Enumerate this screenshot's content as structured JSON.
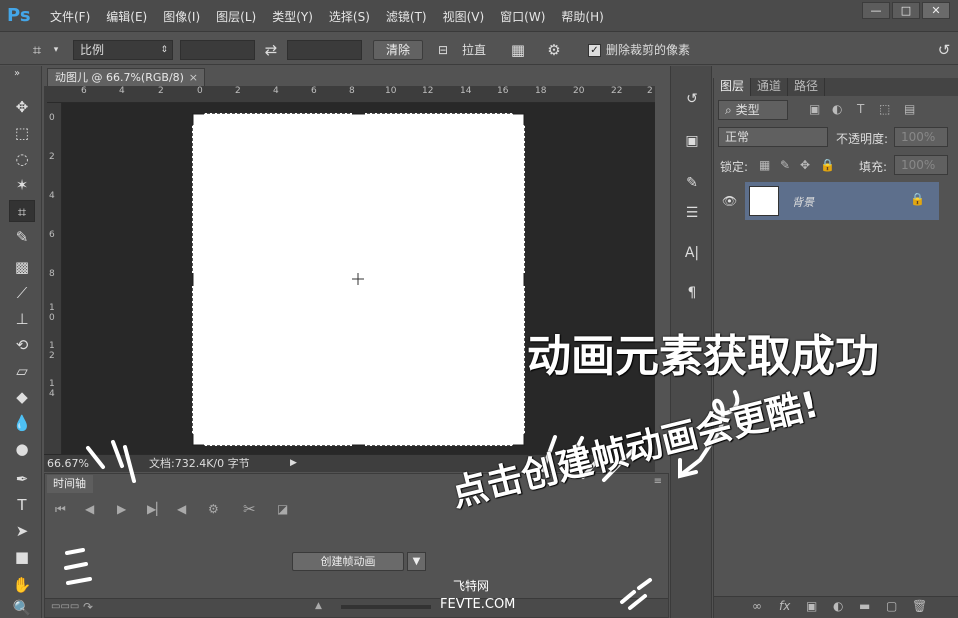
{
  "app": {
    "logo": "Ps"
  },
  "menu": [
    "文件(F)",
    "编辑(E)",
    "图像(I)",
    "图层(L)",
    "类型(Y)",
    "选择(S)",
    "滤镜(T)",
    "视图(V)",
    "窗口(W)",
    "帮助(H)"
  ],
  "window_buttons": {
    "minimize": "—",
    "restore": "□",
    "close": "✕"
  },
  "options": {
    "ratio": "比例",
    "swap_icon": "⇄",
    "clear": "清除",
    "straighten": "拉直",
    "delete_cropped": "删除裁剪的像素",
    "delete_cropped_checked": true
  },
  "document": {
    "tab_title": "动图儿 @ 66.7%(RGB/8)",
    "close": "×",
    "ruler_h": [
      "6",
      "4",
      "2",
      "0",
      "2",
      "4",
      "6",
      "8",
      "10",
      "12",
      "14",
      "16",
      "18",
      "20",
      "22",
      "2"
    ],
    "ruler_v": [
      "0",
      "2",
      "4",
      "6",
      "8",
      "1\n0",
      "1\n2",
      "1\n4"
    ]
  },
  "status": {
    "zoom": "66.67%",
    "doc_info": "文档:732.4K/0 字节"
  },
  "timeline": {
    "tab": "时间轴",
    "create_button": "创建帧动画"
  },
  "layers": {
    "tabs": [
      "图层",
      "通道",
      "路径"
    ],
    "filter": "类型",
    "blend_mode": "正常",
    "opacity_label": "不透明度:",
    "opacity_value": "100%",
    "lock_label": "锁定:",
    "fill_label": "填充:",
    "fill_value": "100%",
    "background_layer": "背景"
  },
  "annotations": {
    "line1": "动画元素获取成功",
    "line2": "点击创建帧动画会更酷!"
  },
  "watermark": {
    "cn": "飞特网",
    "en": "FEVTE.COM"
  }
}
